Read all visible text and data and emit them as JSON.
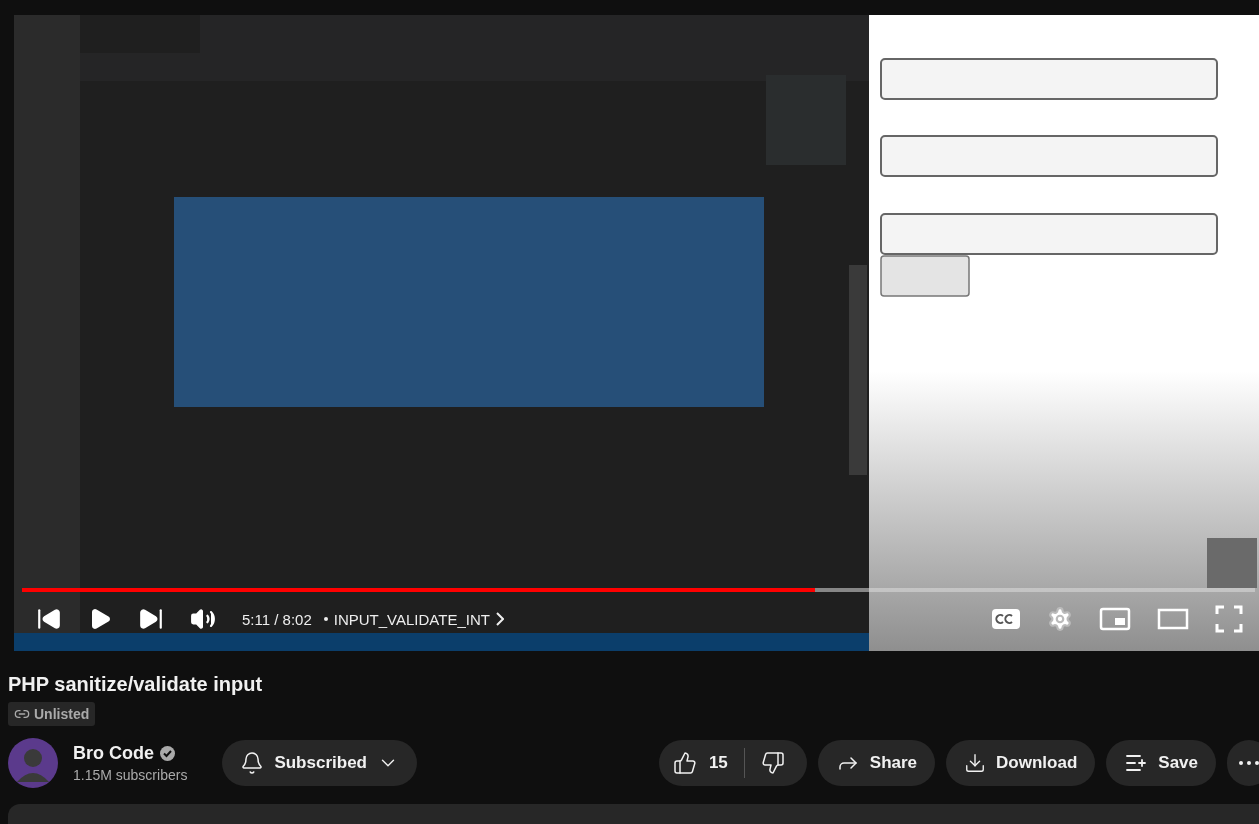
{
  "player": {
    "time": "5:11 / 8:02",
    "chapter": "INPUT_VALIDATE_INT",
    "progress": {
      "level": 0.643
    }
  },
  "video": {
    "title": "PHP sanitize/validate input",
    "visibility": "Unlisted"
  },
  "channel": {
    "name": "Bro Code",
    "subscribers": "1.15M subscribers",
    "subscribe_label": "Subscribed"
  },
  "actions": {
    "likes": "15",
    "buttons": [
      {
        "kind": "share",
        "label": "Share"
      },
      {
        "kind": "download",
        "label": "Download"
      },
      {
        "kind": "save",
        "label": "Save"
      }
    ]
  }
}
